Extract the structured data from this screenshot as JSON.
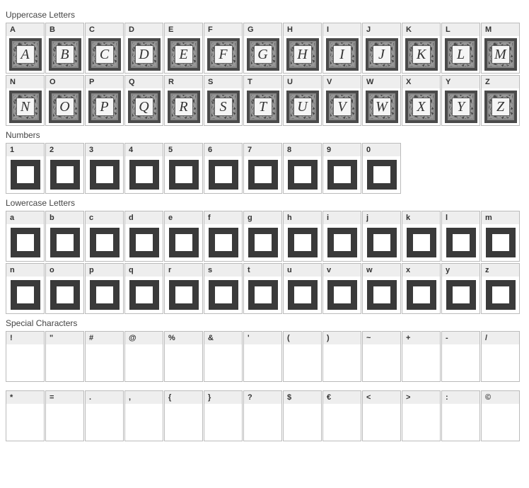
{
  "sections": {
    "uppercase": {
      "title": "Uppercase Letters",
      "rows": [
        [
          "A",
          "B",
          "C",
          "D",
          "E",
          "F",
          "G",
          "H",
          "I",
          "J",
          "K",
          "L",
          "M"
        ],
        [
          "N",
          "O",
          "P",
          "Q",
          "R",
          "S",
          "T",
          "U",
          "V",
          "W",
          "X",
          "Y",
          "Z"
        ]
      ]
    },
    "numbers": {
      "title": "Numbers",
      "rows": [
        [
          "1",
          "2",
          "3",
          "4",
          "5",
          "6",
          "7",
          "8",
          "9",
          "0"
        ]
      ]
    },
    "lowercase": {
      "title": "Lowercase Letters",
      "rows": [
        [
          "a",
          "b",
          "c",
          "d",
          "e",
          "f",
          "g",
          "h",
          "i",
          "j",
          "k",
          "l",
          "m"
        ],
        [
          "n",
          "o",
          "p",
          "q",
          "r",
          "s",
          "t",
          "u",
          "v",
          "w",
          "x",
          "y",
          "z"
        ]
      ]
    },
    "special": {
      "title": "Special Characters",
      "rows": [
        [
          "!",
          "\"",
          "#",
          "@",
          "%",
          "&",
          "'",
          "(",
          ")",
          "~",
          "+",
          "-",
          "/"
        ],
        [
          "*",
          "=",
          ".",
          ",",
          "{",
          "}",
          "?",
          "$",
          "€",
          "<",
          ">",
          ":",
          "©"
        ]
      ]
    }
  }
}
